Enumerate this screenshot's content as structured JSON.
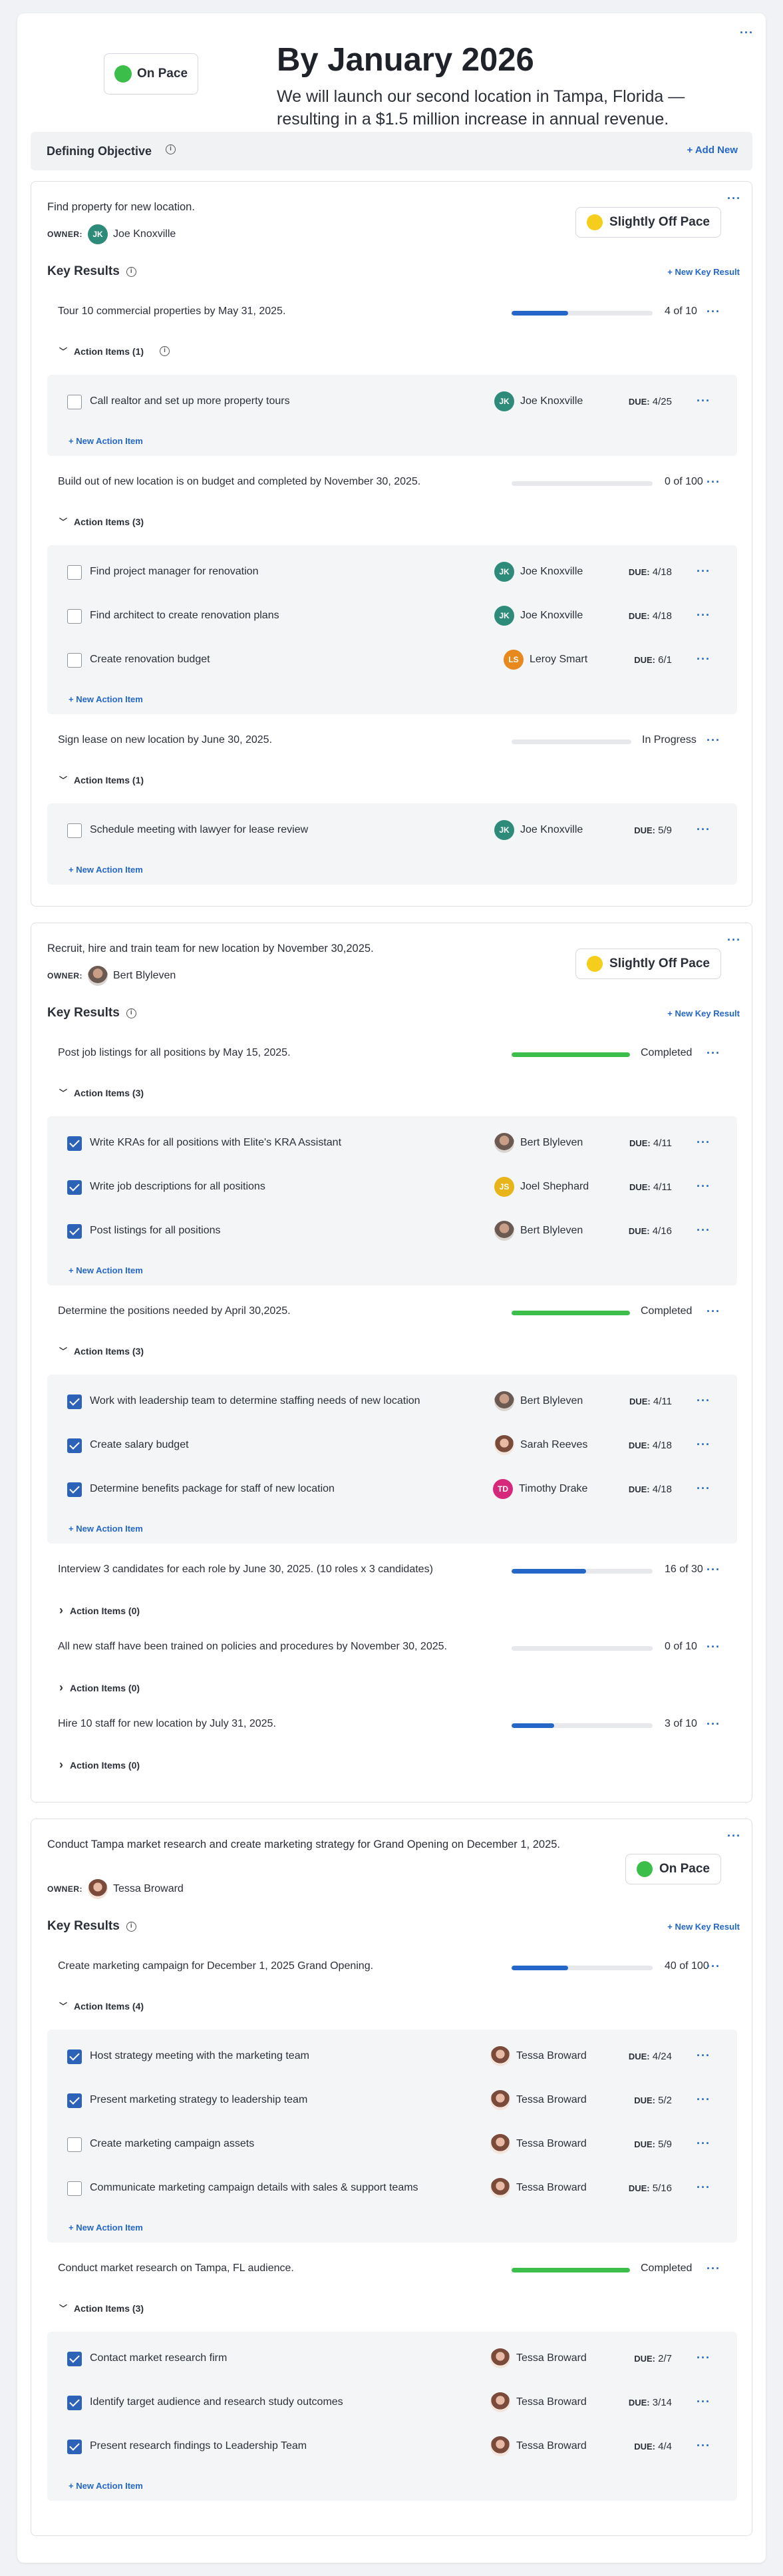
{
  "header": {
    "status_label": "On Pace",
    "title": "By January 2026",
    "subtitle": "We will launch our second location in Tampa, Florida — resulting in a $1.5 million increase in annual revenue."
  },
  "defbar": {
    "label": "Defining Objective",
    "add_label": "+ Add New"
  },
  "common": {
    "owner_label": "OWNER:",
    "key_results_label": "Key Results",
    "new_key_result": "+ New Key Result",
    "new_action_item": "+ New Action Item",
    "due_label": "DUE:"
  },
  "colors": {
    "accent": "#2467c8",
    "on_pace": "#3bbf4a",
    "off_pace": "#f5cd1c",
    "progress_blue": "#2467c8",
    "progress_green": "#3bbf4a"
  },
  "objectives": [
    {
      "title": "Find property for new location.",
      "owner": "Joe Knoxville",
      "owner_initials": "JK",
      "status": "Slightly Off Pace",
      "key_results": [
        {
          "title": "Tour 10 commercial properties by May 31, 2025.",
          "value": "4 of 10",
          "progress": 0.4,
          "ai_header": "Action Items (1)",
          "items": [
            {
              "text": "Call realtor and set up more property tours",
              "done": false,
              "assignee": "Joe Knoxville",
              "initials": "JK",
              "due": "4/25"
            }
          ]
        },
        {
          "title": "Build out of new location is on budget and completed by November 30, 2025.",
          "value": "0 of 100",
          "progress": 0,
          "ai_header": "Action Items (3)",
          "items": [
            {
              "text": "Find project manager for renovation",
              "done": false,
              "assignee": "Joe Knoxville",
              "initials": "JK",
              "due": "4/18"
            },
            {
              "text": "Find architect to create renovation plans",
              "done": false,
              "assignee": "Joe Knoxville",
              "initials": "JK",
              "due": "4/18"
            },
            {
              "text": "Create renovation budget",
              "done": false,
              "assignee": "Leroy Smart",
              "initials": "LS",
              "due": "6/1"
            }
          ]
        },
        {
          "title": "Sign lease on new location by June 30, 2025.",
          "value": "In Progress",
          "progress": 0,
          "ai_header": "Action Items (1)",
          "items": [
            {
              "text": "Schedule meeting with lawyer for lease review",
              "done": false,
              "assignee": "Joe Knoxville",
              "initials": "JK",
              "due": "5/9"
            }
          ]
        }
      ]
    },
    {
      "title": "Recruit, hire and train team for new location by November 30,2025.",
      "owner": "Bert Blyleven",
      "status": "Slightly Off Pace",
      "key_results": [
        {
          "title": "Post job listings for all positions by May 15, 2025.",
          "value": "Completed",
          "progress": 1,
          "ai_header": "Action Items (3)",
          "items": [
            {
              "text": "Write KRAs for all positions with Elite's KRA Assistant",
              "done": true,
              "assignee": "Bert Blyleven",
              "due": "4/11"
            },
            {
              "text": "Write job descriptions for all positions",
              "done": true,
              "assignee": "Joel Shephard",
              "initials": "JS",
              "due": "4/11"
            },
            {
              "text": "Post listings for all positions",
              "done": true,
              "assignee": "Bert Blyleven",
              "due": "4/16"
            }
          ]
        },
        {
          "title": "Determine the positions needed by April 30,2025.",
          "value": "Completed",
          "progress": 1,
          "ai_header": "Action Items (3)",
          "items": [
            {
              "text": "Work with leadership team to determine staffing needs of new location",
              "done": true,
              "assignee": "Bert Blyleven",
              "due": "4/11"
            },
            {
              "text": "Create salary budget",
              "done": true,
              "assignee": "Sarah Reeves",
              "due": "4/18"
            },
            {
              "text": "Determine benefits package for staff of new location",
              "done": true,
              "assignee": "Timothy Drake",
              "initials": "TD",
              "due": "4/18"
            }
          ]
        },
        {
          "title": "Interview 3 candidates for each role by June 30, 2025. (10 roles x 3 candidates)",
          "value": "16 of 30",
          "progress": 0.53,
          "ai_header": "Action Items (0)",
          "items": []
        },
        {
          "title": "All new staff have been trained on policies and procedures by November 30, 2025.",
          "value": "0 of 10",
          "progress": 0,
          "ai_header": "Action Items (0)",
          "items": []
        },
        {
          "title": "Hire 10 staff for new location by July 31, 2025.",
          "value": "3 of 10",
          "progress": 0.3,
          "ai_header": "Action Items (0)",
          "items": []
        }
      ]
    },
    {
      "title": "Conduct Tampa market research and create marketing strategy for Grand Opening on December 1, 2025.",
      "owner": "Tessa Broward",
      "status": "On Pace",
      "key_results": [
        {
          "title": "Create marketing campaign for December 1, 2025 Grand Opening.",
          "value": "40 of 100",
          "progress": 0.4,
          "ai_header": "Action Items (4)",
          "items": [
            {
              "text": "Host strategy meeting with the marketing team",
              "done": true,
              "assignee": "Tessa Broward",
              "due": "4/24"
            },
            {
              "text": "Present marketing strategy to leadership team",
              "done": true,
              "assignee": "Tessa Broward",
              "due": "5/2"
            },
            {
              "text": "Create marketing campaign assets",
              "done": false,
              "assignee": "Tessa Broward",
              "due": "5/9"
            },
            {
              "text": "Communicate marketing campaign details with sales & support teams",
              "done": false,
              "assignee": "Tessa Broward",
              "due": "5/16"
            }
          ]
        },
        {
          "title": "Conduct market research on Tampa, FL audience.",
          "value": "Completed",
          "progress": 1,
          "ai_header": "Action Items (3)",
          "items": [
            {
              "text": "Contact market research firm",
              "done": true,
              "assignee": "Tessa Broward",
              "due": "2/7"
            },
            {
              "text": "Identify target audience and research study outcomes",
              "done": true,
              "assignee": "Tessa Broward",
              "due": "3/14"
            },
            {
              "text": "Present research findings to Leadership Team",
              "done": true,
              "assignee": "Tessa Broward",
              "due": "4/4"
            }
          ]
        }
      ]
    }
  ]
}
